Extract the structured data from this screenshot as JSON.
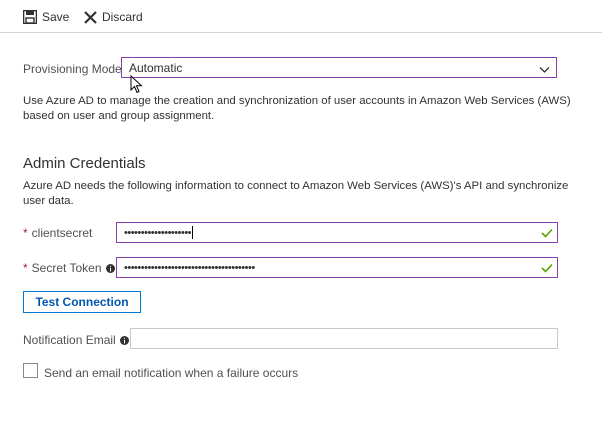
{
  "toolbar": {
    "save_label": "Save",
    "discard_label": "Discard"
  },
  "provisioning": {
    "label": "Provisioning Mode",
    "selected": "Automatic",
    "description_line1": "Use Azure AD to manage the creation and synchronization of user accounts in Amazon Web Services (AWS)",
    "description_line2": "based on user and group assignment."
  },
  "admin": {
    "title": "Admin Credentials",
    "description_line1": "Azure AD needs the following information to connect to Amazon Web Services (AWS)'s API and synchronize",
    "description_line2": "user data.",
    "client_secret": {
      "required_mark": "*",
      "label": "clientsecret",
      "value": "••••••••••••••••••••"
    },
    "secret_token": {
      "required_mark": "*",
      "label": "Secret Token",
      "value": "•••••••••••••••••••••••••••••••••••••••"
    },
    "test_button": "Test Connection",
    "notification_email": {
      "label": "Notification Email",
      "value": ""
    },
    "send_email_checkbox": {
      "label": "Send an email notification when a failure occurs",
      "checked": false
    }
  },
  "colors": {
    "focus_border": "#8a3fb0",
    "valid_check": "#57a300",
    "link_blue": "#0078d4",
    "required": "#a4262c"
  },
  "icons": {
    "save": "save-icon",
    "discard": "close-icon",
    "dropdown": "chevron-down-icon",
    "valid": "checkmark-icon",
    "info": "info-icon"
  }
}
